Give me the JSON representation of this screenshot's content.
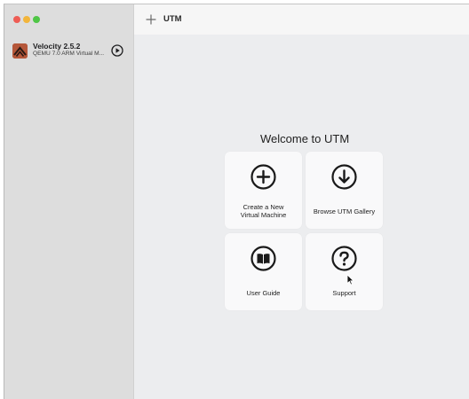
{
  "sidebar": {
    "vm": {
      "name": "Velocity 2.5.2",
      "subtitle": "QEMU 7.0 ARM Virtual M..."
    }
  },
  "toolbar": {
    "title": "UTM"
  },
  "main": {
    "welcome": "Welcome to UTM",
    "tiles": [
      {
        "line1": "Create a New",
        "line2": "Virtual Machine",
        "icon": "plus-circle-icon"
      },
      {
        "line1": "Browse UTM Gallery",
        "line2": "",
        "icon": "arrow-down-circle-icon"
      },
      {
        "line1": "User Guide",
        "line2": "",
        "icon": "book-icon"
      },
      {
        "line1": "Support",
        "line2": "",
        "icon": "question-circle-icon"
      }
    ]
  },
  "colors": {
    "close": "#ee5d55",
    "minimize": "#f2b53b",
    "zoom": "#4fc646",
    "vm_logo": "#b5573a"
  }
}
